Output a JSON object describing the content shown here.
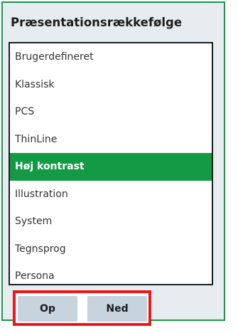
{
  "panel": {
    "title": "Præsentationsrækkefølge"
  },
  "list": {
    "items": [
      {
        "label": "Brugerdefineret"
      },
      {
        "label": "Klassisk"
      },
      {
        "label": "PCS"
      },
      {
        "label": "ThinLine"
      },
      {
        "label": "Høj kontrast",
        "selected": true
      },
      {
        "label": "Illustration"
      },
      {
        "label": "System"
      },
      {
        "label": "Tegnsprog"
      },
      {
        "label": "Persona"
      }
    ]
  },
  "buttons": {
    "up_label": "Op",
    "down_label": "Ned"
  },
  "colors": {
    "accent": "#149a45",
    "panel_bg": "#e6ecf0",
    "button_bg": "#c7d3dd",
    "highlight_border": "#e8181d"
  }
}
